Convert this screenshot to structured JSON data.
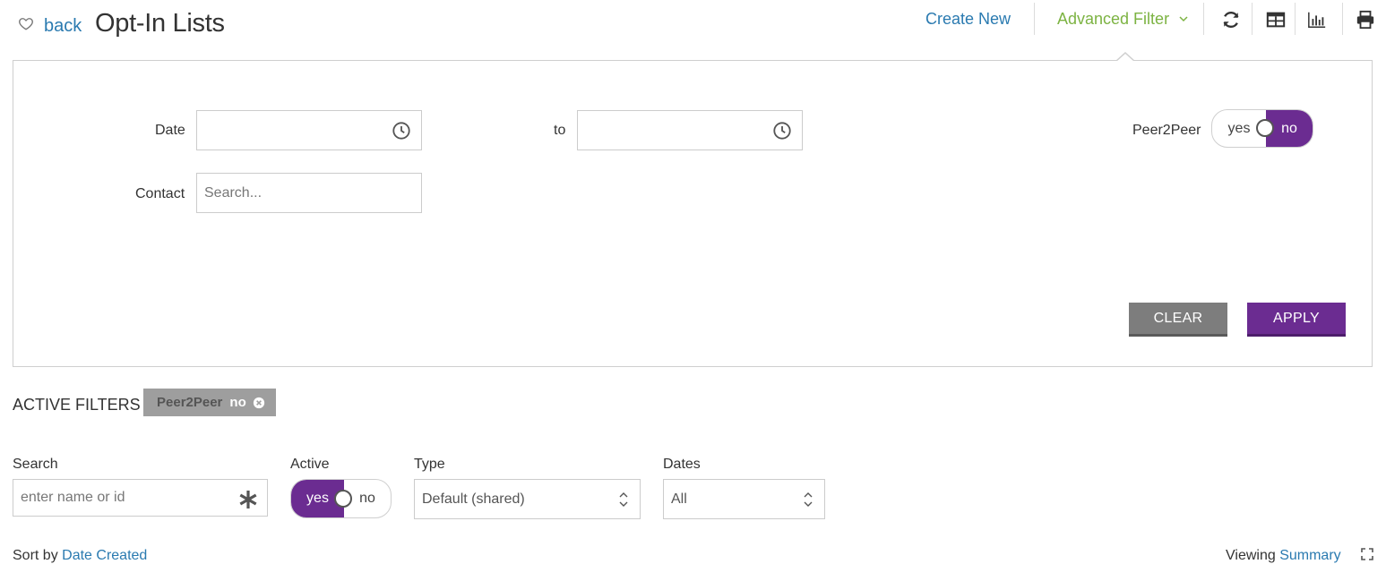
{
  "header": {
    "back_label": "back",
    "title": "Opt-In Lists",
    "create_new": "Create New",
    "advanced_filter": "Advanced Filter"
  },
  "icons": {
    "favorite": "heart-icon",
    "advanced_filter_chevron": "chevron-down-icon",
    "refresh": "refresh-icon",
    "table_view": "table-icon",
    "chart": "bar-chart-icon",
    "print": "print-icon",
    "date_picker": "clock-icon",
    "remove_chip": "close-circle-icon",
    "search_clear": "asterisk-icon",
    "select_arrows": "up-down-arrows-icon",
    "expand": "expand-icon"
  },
  "filter_panel": {
    "date_label": "Date",
    "to_label": "to",
    "date_from_value": "",
    "date_to_value": "",
    "contact_label": "Contact",
    "contact_placeholder": "Search...",
    "peer2peer_label": "Peer2Peer",
    "peer2peer_toggle": {
      "yes": "yes",
      "no": "no",
      "selected": "no"
    },
    "clear_button": "CLEAR",
    "apply_button": "APPLY"
  },
  "active_filters": {
    "label": "ACTIVE FILTERS",
    "chips": [
      {
        "key": "Peer2Peer",
        "value": "no"
      }
    ]
  },
  "list_filters": {
    "search_label": "Search",
    "search_placeholder": "enter name or id",
    "active_label": "Active",
    "active_toggle": {
      "yes": "yes",
      "no": "no",
      "selected": "yes"
    },
    "type_label": "Type",
    "type_value": "Default (shared)",
    "dates_label": "Dates",
    "dates_value": "All"
  },
  "sort": {
    "prefix": "Sort by",
    "field": "Date Created",
    "viewing_prefix": "Viewing",
    "viewing_value": "Summary"
  },
  "colors": {
    "primary_purple": "#6b2c91",
    "link_blue": "#2a7ab0",
    "filter_green": "#7cb342",
    "clear_grey": "#7d7d7d",
    "chip_grey": "#9e9e9e"
  }
}
